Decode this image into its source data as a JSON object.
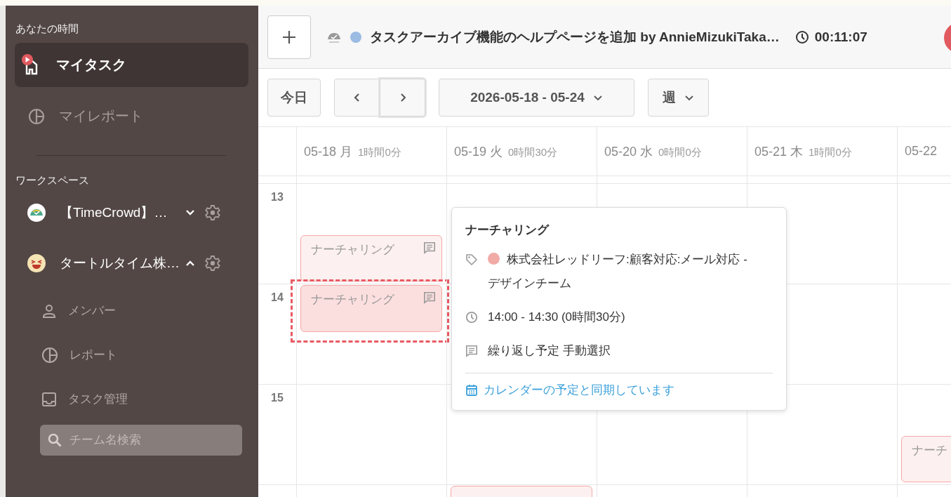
{
  "sidebar": {
    "section_title": "あなたの時間",
    "items": [
      {
        "label": "マイタスク",
        "kind": "mytask",
        "selected": true
      },
      {
        "label": "マイレポート",
        "kind": "report",
        "selected": false
      }
    ],
    "workspace_title": "ワークスペース",
    "workspaces": [
      {
        "name": "【TimeCrowd】…",
        "kind": "logo",
        "expanded": false
      },
      {
        "name": "タートルタイム株…",
        "kind": "smile",
        "expanded": true,
        "children": [
          {
            "label": "メンバー",
            "kind": "member"
          },
          {
            "label": "レポート",
            "kind": "report"
          },
          {
            "label": "タスク管理",
            "kind": "tasks"
          }
        ]
      }
    ],
    "team_search": {
      "placeholder": "チーム名検索"
    }
  },
  "header": {
    "running_task": {
      "title": "タスクアーカイブ機能のヘルプページを追加 by AnnieMizukiTaka…",
      "color": "#9bbbe3"
    },
    "timer": "00:11:07"
  },
  "toolbar": {
    "today": "今日",
    "range": "2026-05-18 - 05-24",
    "view": "週"
  },
  "calendar": {
    "hours": [
      "13",
      "14",
      "15"
    ],
    "days": [
      {
        "date": "05-18 月",
        "total": "1時間0分",
        "slots": [
          {
            "kind": "free"
          },
          {
            "kind": "event",
            "title": "ナーチャリング",
            "note": true,
            "selected": false
          },
          {
            "kind": "event",
            "title": "ナーチャリング",
            "note": true,
            "selected": true
          }
        ]
      },
      {
        "date": "05-19 火",
        "total": "0時間30分",
        "slots": [
          {
            "kind": "free"
          },
          {
            "kind": "free"
          },
          {
            "kind": "free"
          },
          {
            "kind": "free"
          },
          {
            "kind": "free"
          },
          {
            "kind": "free"
          },
          {
            "kind": "event",
            "note": false,
            "selected": false
          }
        ]
      },
      {
        "date": "05-20 水",
        "total": "0時間0分"
      },
      {
        "date": "05-21 木",
        "total": "1時間0分"
      },
      {
        "date": "05-22",
        "slots": [
          {
            "kind": "free"
          },
          {
            "kind": "free"
          },
          {
            "kind": "free"
          },
          {
            "kind": "free"
          },
          {
            "kind": "free"
          },
          {
            "kind": "event",
            "title": "ナーチ",
            "note": false,
            "selected": false
          }
        ]
      }
    ]
  },
  "popover": {
    "title": "ナーチャリング",
    "tag": {
      "color": "#f2aaa6",
      "text": "株式会社レッドリーフ:顧客対応:メール対応 - デザインチーム"
    },
    "time": "14:00 - 14:30 (0時間30分)",
    "note": "繰り返し予定 手動選択",
    "sync_link": "カレンダーの予定と同期しています"
  }
}
